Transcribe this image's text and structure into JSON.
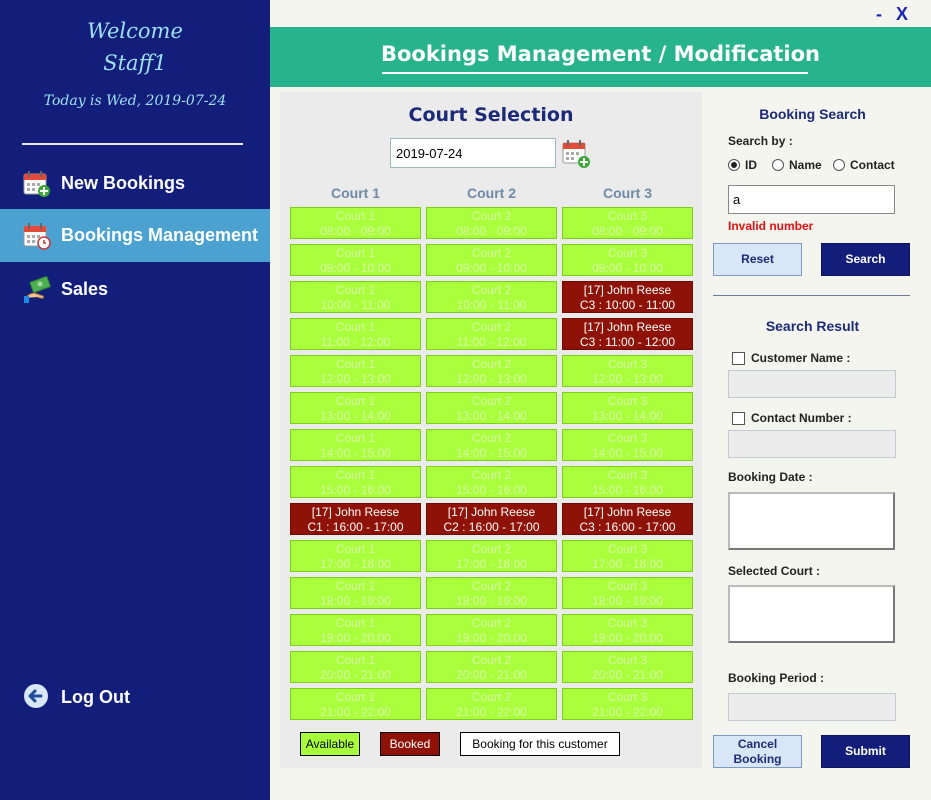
{
  "window": {
    "minimize": "-",
    "close": "X"
  },
  "sidebar": {
    "welcome_line1": "Welcome",
    "welcome_line2": "Staff1",
    "today": "Today is Wed, 2019-07-24",
    "items": [
      {
        "label": "New Bookings",
        "icon": "calendar-add-icon"
      },
      {
        "label": "Bookings Management",
        "icon": "calendar-clock-icon",
        "active": true
      },
      {
        "label": "Sales",
        "icon": "money-hand-icon"
      }
    ],
    "logout": {
      "label": "Log Out",
      "icon": "back-arrow-icon"
    }
  },
  "header": {
    "title": "Bookings Management / Modification"
  },
  "court_panel": {
    "title": "Court Selection",
    "date_value": "2019-07-24",
    "columns": [
      "Court 1",
      "Court 2",
      "Court 3"
    ],
    "slots": [
      [
        "Court 1\n08:00 - 09:00",
        "Court 2\n08:00 - 09:00",
        "Court 3\n08:00 - 09:00"
      ],
      [
        "Court 1\n09:00 - 10:00",
        "Court 2\n09:00 - 10:00",
        "Court 3\n09:00 - 10:00"
      ],
      [
        "Court 1\n10:00 - 11:00",
        "Court 2\n10:00 - 11:00",
        "[17] John Reese\nC3 : 10:00 - 11:00"
      ],
      [
        "Court 1\n11:00 - 12:00",
        "Court 2\n11:00 - 12:00",
        "[17] John Reese\nC3 : 11:00 - 12:00"
      ],
      [
        "Court 1\n12:00 - 13:00",
        "Court 2\n12:00 - 13:00",
        "Court 3\n12:00 - 13:00"
      ],
      [
        "Court 1\n13:00 - 14:00",
        "Court 2\n13:00 - 14:00",
        "Court 3\n13:00 - 14:00"
      ],
      [
        "Court 1\n14:00 - 15:00",
        "Court 2\n14:00 - 15:00",
        "Court 3\n14:00 - 15:00"
      ],
      [
        "Court 1\n15:00 - 16:00",
        "Court 2\n15:00 - 16:00",
        "Court 3\n15:00 - 16:00"
      ],
      [
        "[17] John Reese\nC1 : 16:00 - 17:00",
        "[17] John Reese\nC2 : 16:00 - 17:00",
        "[17] John Reese\nC3 : 16:00 - 17:00"
      ],
      [
        "Court 1\n17:00 - 18:00",
        "Court 2\n17:00 - 18:00",
        "Court 3\n17:00 - 18:00"
      ],
      [
        "Court 1\n18:00 - 19:00",
        "Court 2\n18:00 - 19:00",
        "Court 3\n18:00 - 19:00"
      ],
      [
        "Court 1\n19:00 - 20:00",
        "Court 2\n19:00 - 20:00",
        "Court 3\n19:00 - 20:00"
      ],
      [
        "Court 1\n20:00 - 21:00",
        "Court 2\n20:00 - 21:00",
        "Court 3\n20:00 - 21:00"
      ],
      [
        "Court 1\n21:00 - 22:00",
        "Court 2\n21:00 - 22:00",
        "Court 3\n21:00 - 22:00"
      ]
    ],
    "status": [
      [
        "available",
        "available",
        "available"
      ],
      [
        "available",
        "available",
        "available"
      ],
      [
        "available",
        "available",
        "booked"
      ],
      [
        "available",
        "available",
        "booked"
      ],
      [
        "available",
        "available",
        "available"
      ],
      [
        "available",
        "available",
        "available"
      ],
      [
        "available",
        "available",
        "available"
      ],
      [
        "available",
        "available",
        "available"
      ],
      [
        "booked",
        "booked",
        "booked"
      ],
      [
        "available",
        "available",
        "available"
      ],
      [
        "available",
        "available",
        "available"
      ],
      [
        "available",
        "available",
        "available"
      ],
      [
        "available",
        "available",
        "available"
      ],
      [
        "available",
        "available",
        "available"
      ]
    ],
    "legend": {
      "available": "Available",
      "booked": "Booked",
      "customer": "Booking for this customer"
    },
    "colors": {
      "available": "#aaff3c",
      "booked": "#8e1208"
    }
  },
  "search_panel": {
    "title": "Booking Search",
    "search_by_label": "Search by :",
    "radios": [
      {
        "label": "ID",
        "checked": true
      },
      {
        "label": "Name",
        "checked": false
      },
      {
        "label": "Contact",
        "checked": false
      }
    ],
    "search_value": "a",
    "error": "Invalid number",
    "reset_label": "Reset",
    "search_label": "Search",
    "result_title": "Search Result",
    "customer_name_label": "Customer Name :",
    "contact_number_label": "Contact Number :",
    "booking_date_label": "Booking Date :",
    "selected_court_label": "Selected Court :",
    "booking_period_label": "Booking Period :",
    "cancel_label_1": "Cancel",
    "cancel_label_2": "Booking",
    "submit_label": "Submit"
  }
}
